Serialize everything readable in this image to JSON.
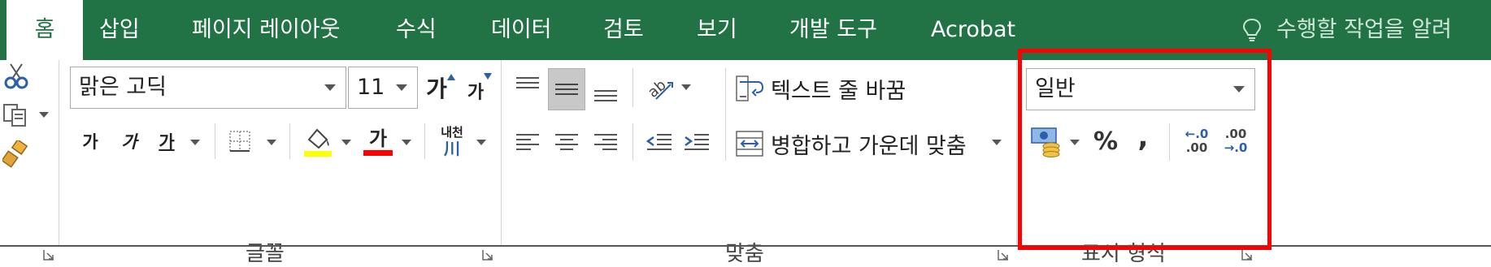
{
  "tabs": [
    {
      "label": "홈",
      "active": true
    },
    {
      "label": "삽입"
    },
    {
      "label": "페이지 레이아웃"
    },
    {
      "label": "수식"
    },
    {
      "label": "데이터"
    },
    {
      "label": "검토"
    },
    {
      "label": "보기"
    },
    {
      "label": "개발 도구"
    },
    {
      "label": "Acrobat"
    }
  ],
  "tell_me": {
    "text": "수행할 작업을 알려",
    "icon": "lightbulb-icon"
  },
  "font": {
    "name": "맑은 고딕",
    "size": "11",
    "grow_glyph": "가",
    "shrink_glyph": "가",
    "bold_glyph": "가",
    "italic_glyph": "가",
    "underline_glyph": "가",
    "font_color_glyph": "가",
    "phonetic_glyph_top": "내천",
    "phonetic_glyph_bottom": "川",
    "group_label": "글꼴",
    "fill_color": "#ffff00",
    "font_color": "#ff0000"
  },
  "alignment": {
    "wrap_text_label": "텍스트 줄 바꿈",
    "merge_center_label": "병합하고 가운데 맞춤",
    "group_label": "맞춤"
  },
  "number": {
    "format_value": "일반",
    "percent_glyph": "%",
    "comma_glyph": ",",
    "increase_decimal_top": "←.0",
    "increase_decimal_bottom": ".00",
    "decrease_decimal_top": ".00",
    "decrease_decimal_bottom": "→.0",
    "group_label": "표시 형식"
  },
  "colors": {
    "tabbar": "#217346",
    "highlight": "#ff0000"
  }
}
